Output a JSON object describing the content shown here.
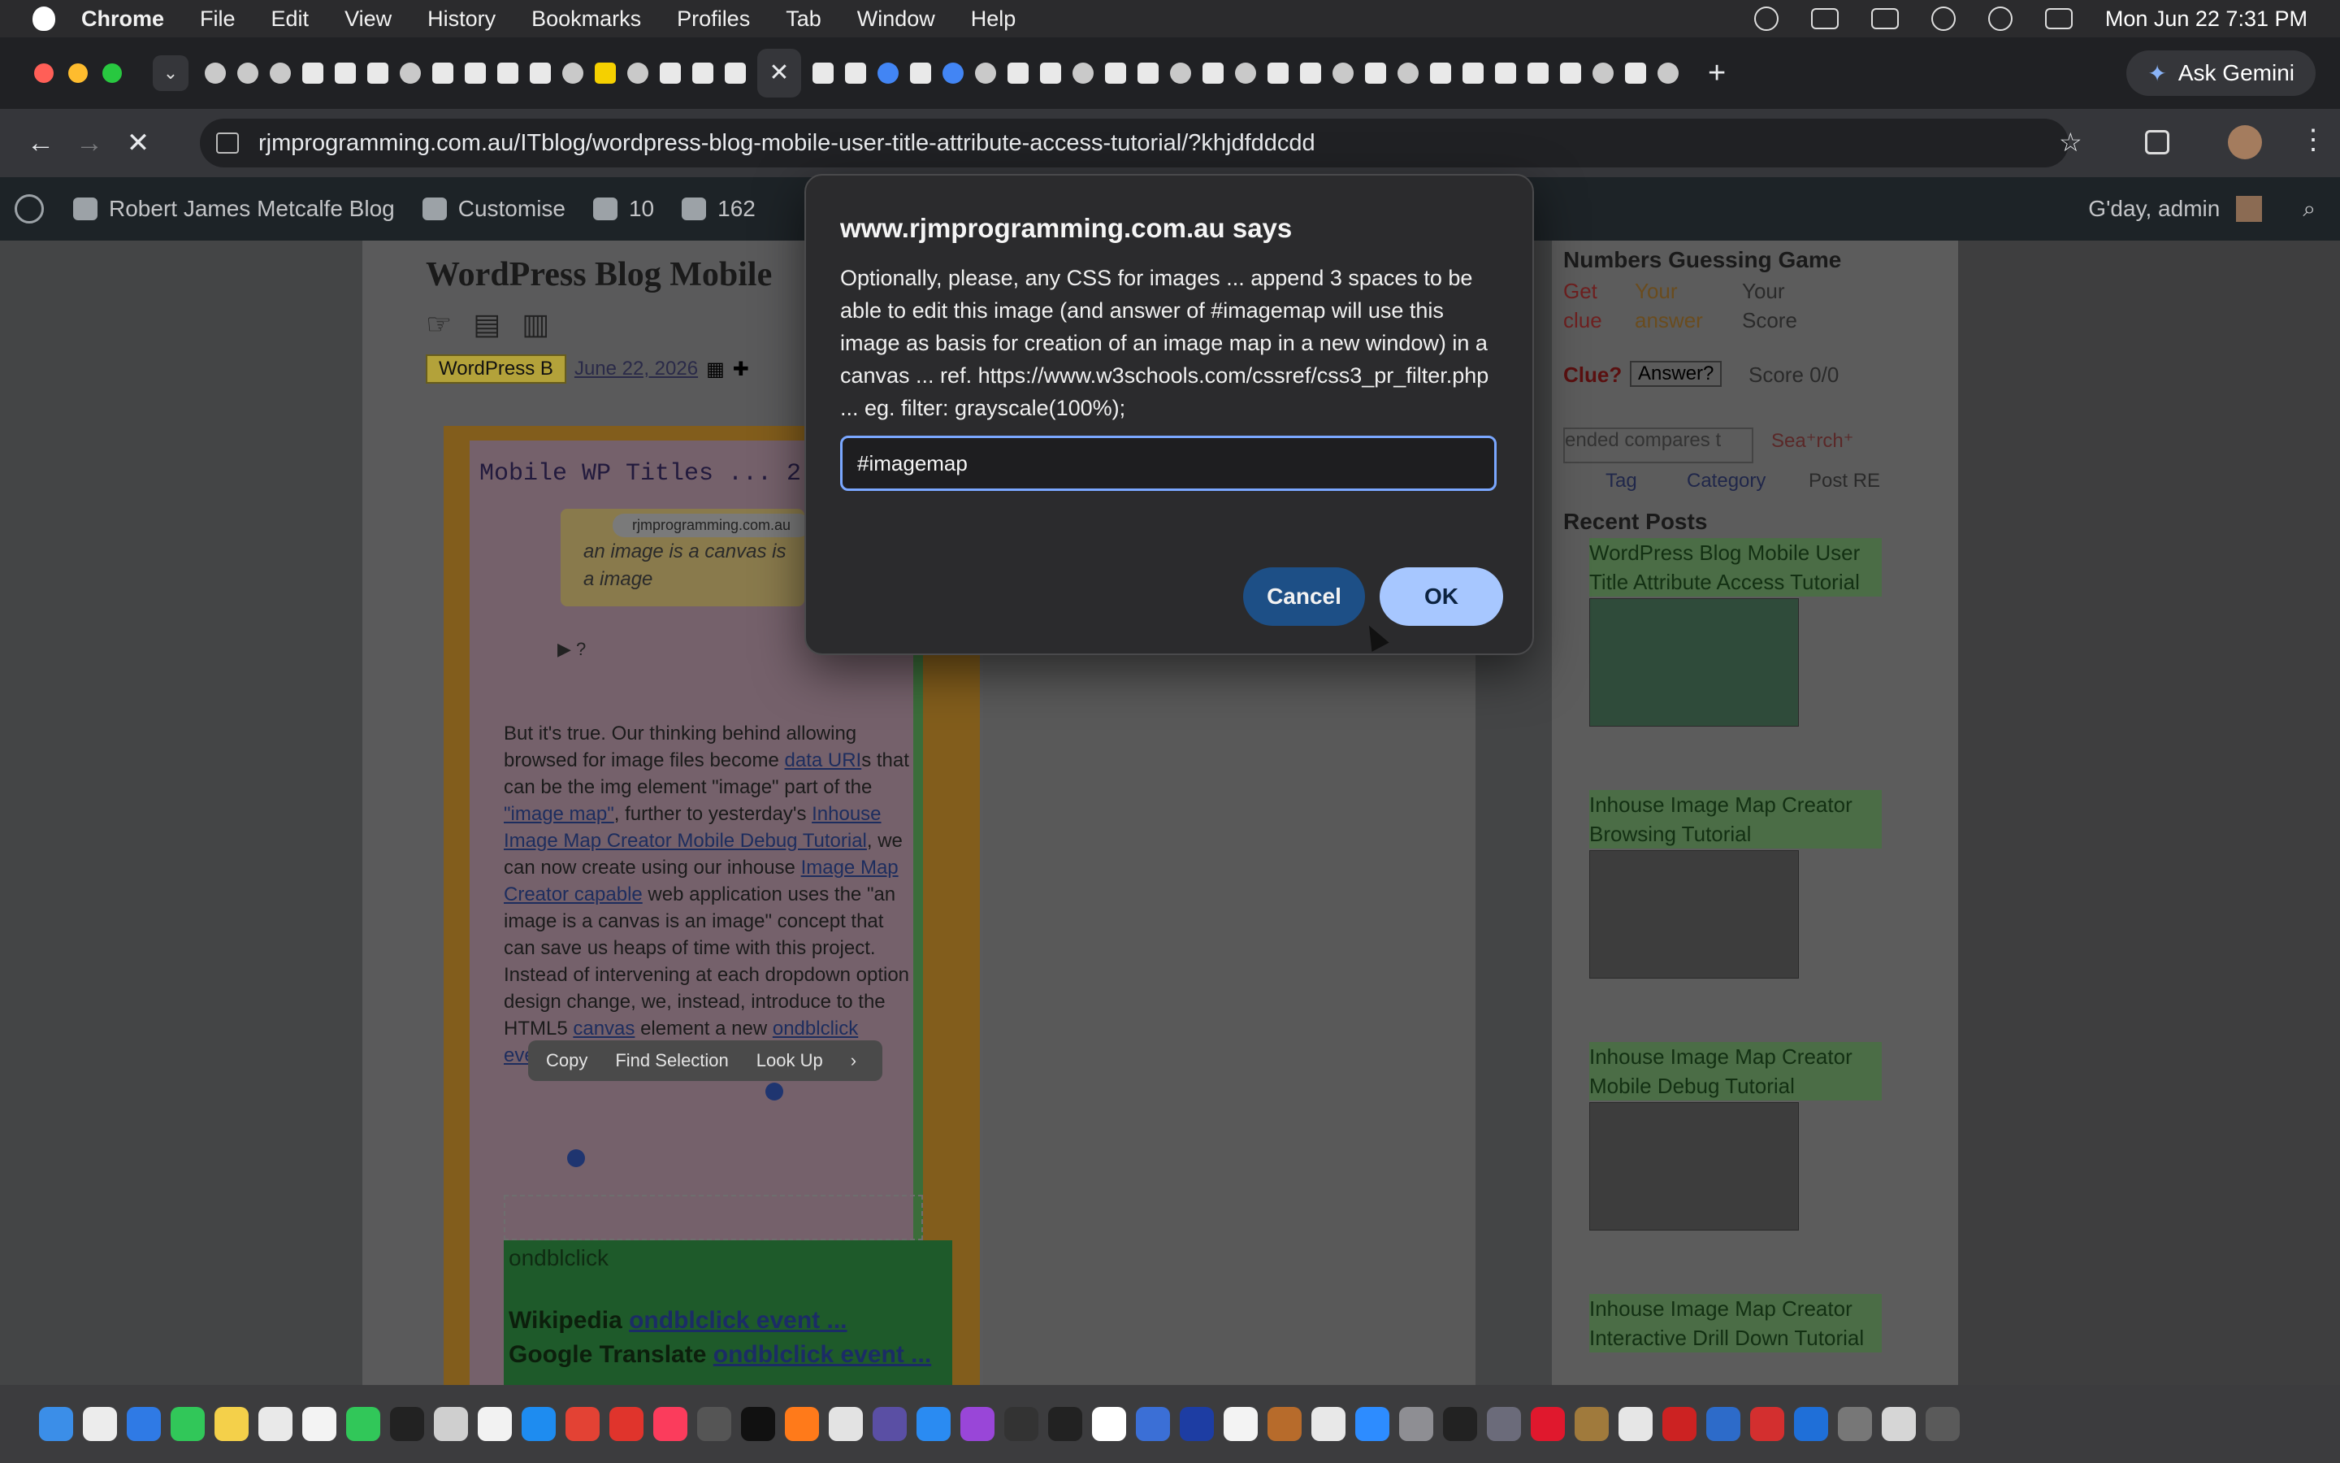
{
  "menubar": {
    "app": "Chrome",
    "items": [
      "File",
      "Edit",
      "View",
      "History",
      "Bookmarks",
      "Profiles",
      "Tab",
      "Window",
      "Help"
    ],
    "clock": "Mon Jun 22  7:31 PM"
  },
  "tabstrip": {
    "active_close": "✕",
    "new_tab": "+",
    "gemini_label": "Ask Gemini"
  },
  "toolbar": {
    "url": "rjmprogramming.com.au/ITblog/wordpress-blog-mobile-user-title-attribute-access-tutorial/?khjdfddcdd"
  },
  "wp_admin": {
    "site": "Robert James Metcalfe Blog",
    "customise": "Customise",
    "updates": "10",
    "comments": "162",
    "greeting": "G'day, admin"
  },
  "post": {
    "title": "WordPress Blog Mobile",
    "category": "WordPress B",
    "date": "June 22, 2026",
    "mono_title": "Mobile WP Titles ... 2",
    "callout_pill": "rjmprogramming.com.au",
    "callout_text": "an image is a canvas is a image",
    "toggle": "▶ ?",
    "body_1": "But it's true.  Our thinking behind allowing browsed for image files become ",
    "link_data_uri": "data URI",
    "body_2": "s that can be the img element \"image\" part of the ",
    "link_image_map": "\"image map\"",
    "body_3": ", further to yesterday's ",
    "link_debug": "Inhouse Image Map Creator Mobile Debug Tutorial",
    "body_4": ", we can now create using our inhouse ",
    "link_creator": "Image Map Creator capable",
    "body_5": " web application uses the \"an image is a canvas is an image\" concept that can save us heaps of time with this project.  Instead of intervening at each dropdown option design change, we, instead, introduce to the HTML5 ",
    "link_canvas": "canvas",
    "body_6": " element a new ",
    "link_event": "ondblclick event",
    "body_7": " ...",
    "selection_menu": [
      "Copy",
      "Find Selection",
      "Look Up"
    ],
    "green_heading": "ondblclick",
    "green_line1_label": "Wikipedia",
    "green_line1_link": "ondblclick event ...",
    "green_line2_label": "Google Translate",
    "green_line2_link": "ondblclick event ..."
  },
  "sidebar": {
    "game_title": "Numbers Guessing Game",
    "get_clue": "Get clue",
    "your_answer": "Your answer",
    "your_score": "Your Score",
    "clue_label": "Clue?",
    "answer_select": "Answer?",
    "score": "Score 0/0",
    "search_value": "ended compares t",
    "search_radio": "Sea⁺rch⁺",
    "tag_radio": "Tag",
    "category_radio": "Category",
    "post_re_check": "Post RE",
    "recent_posts_title": "Recent Posts",
    "recent_posts": [
      "WordPress Blog Mobile User Title Attribute Access Tutorial",
      "Inhouse Image Map Creator Browsing Tutorial",
      "Inhouse Image Map Creator Mobile Debug Tutorial",
      "Inhouse Image Map Creator Interactive Drill Down Tutorial"
    ]
  },
  "dialog": {
    "origin": "www.rjmprogramming.com.au says",
    "message": "Optionally, please, any CSS for images ... append 3 spaces to be able to edit this image (and answer of #imagemap will use this image as basis for creation of an image map in a new window) in a canvas ... ref. https://www.w3schools.com/cssref/css3_pr_filter.php ... eg.           filter: grayscale(100%);",
    "input_value": "#imagemap",
    "cancel_label": "Cancel",
    "ok_label": "OK"
  },
  "colors": {
    "dialog_ok": "#a7c7ff",
    "dialog_cancel": "#1d4f86",
    "input_focus": "#7aa7ff"
  }
}
